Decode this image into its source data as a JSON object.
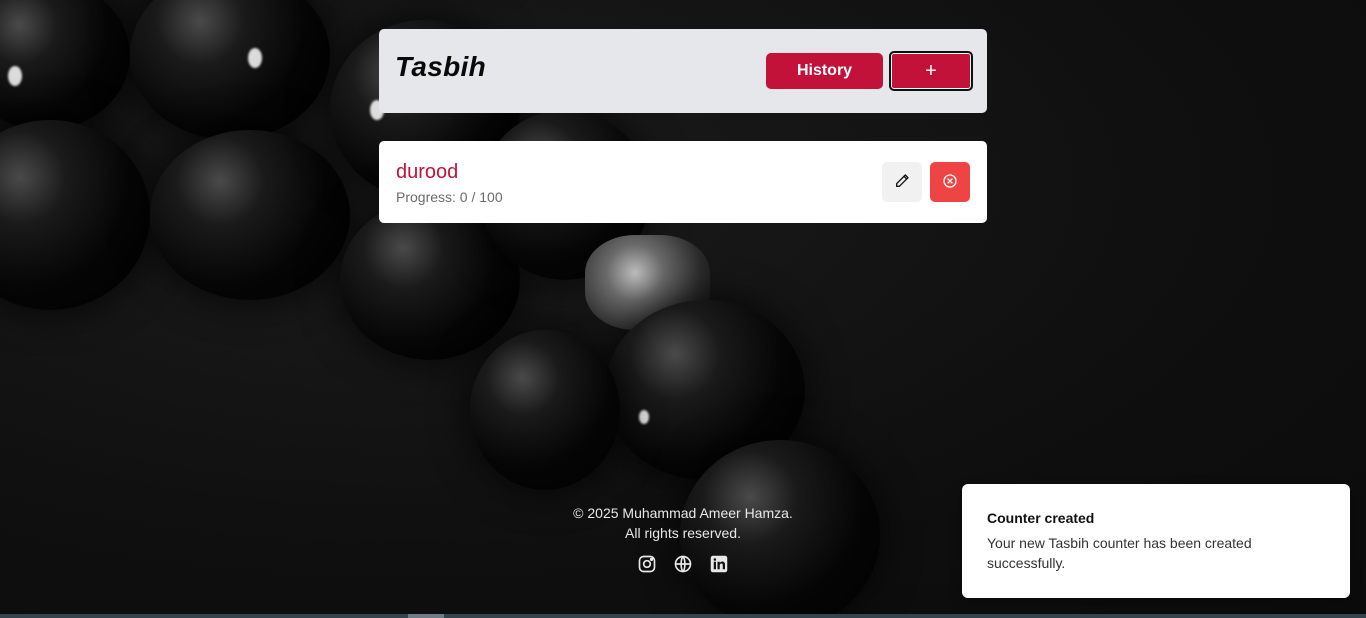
{
  "app": {
    "title": "Tasbih"
  },
  "header": {
    "history_label": "History",
    "add_label": "+"
  },
  "counters": [
    {
      "name": "durood",
      "progress_label": "Progress: 0 / 100",
      "progress": 0,
      "target": 100
    }
  ],
  "footer": {
    "copyright": "© 2025 Muhammad Ameer Hamza.",
    "rights": "All rights reserved."
  },
  "socials": [
    "instagram-icon",
    "globe-icon",
    "linkedin-icon"
  ],
  "toast": {
    "title": "Counter created",
    "description": "Your new Tasbih counter has been created successfully."
  },
  "colors": {
    "accent": "#c2123a",
    "danger": "#ef4444",
    "header_bg": "#e5e7eb"
  }
}
